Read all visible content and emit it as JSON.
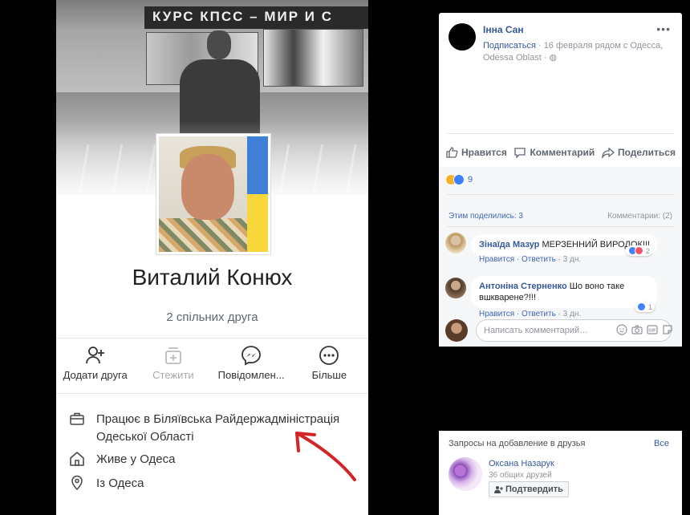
{
  "profile": {
    "cover_banner_text": "КУРС КПСС – МИР И С",
    "name": "Виталий Конюх",
    "mutual_friends": "2 спільних друга",
    "actions": [
      {
        "label": "Додати друга",
        "icon": "add-friend-icon"
      },
      {
        "label": "Стежити",
        "icon": "follow-icon"
      },
      {
        "label": "Повідомлен...",
        "icon": "messenger-icon"
      },
      {
        "label": "Більше",
        "icon": "more-icon"
      }
    ],
    "work_line1": "Працює в Біляївська Райдержадміністрація",
    "work_line2": "Одеської Області",
    "lives": "Живе у Одеса",
    "from": "Із Одеса",
    "colors": {
      "flag_blue": "#3f7fd6",
      "flag_yellow": "#f7d73a",
      "arrow": "#d32525"
    }
  },
  "post": {
    "author": "Інна Сан",
    "meta_link": "Подписаться",
    "meta_dot": " · ",
    "meta_rest": "16 февраля рядом с Одесса,",
    "meta_line2": "Odessa Oblast",
    "meta_line2_sep": " · ",
    "actions": {
      "like": "Нравится",
      "comment": "Комментарий",
      "share": "Поделиться"
    },
    "reaction_count": "9",
    "shares": "Этим поделились: 3",
    "comments_count": "Комментарии: (2)",
    "comments": [
      {
        "author": "Зінаїда Мазур",
        "text": "МЕРЗЕННИЙ ВИРОДОК!!!",
        "like": "Нравится",
        "reply": "Ответить",
        "time": "3 дн.",
        "reactions": "2"
      },
      {
        "author": "Антоніна Стерненко",
        "text": "Шо воно таке",
        "text2": "вшкварене?!!!",
        "like": "Нравится",
        "reply": "Ответить",
        "time": "3 дн.",
        "reactions": "1"
      }
    ],
    "comment_placeholder": "Написать комментарий…"
  },
  "friend_requests": {
    "title": "Запросы на добавление в друзья",
    "see_all": "Все",
    "request": {
      "name": "Оксана Назарук",
      "mutual": "36 общих друзей",
      "confirm": "Подтвердить"
    }
  }
}
